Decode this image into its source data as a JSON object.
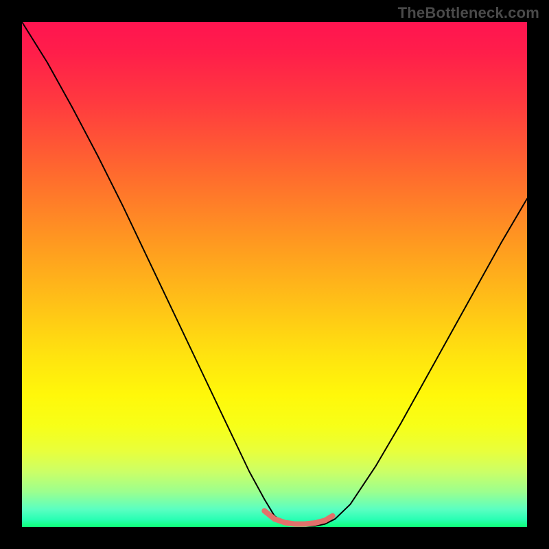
{
  "watermark": "TheBottleneck.com",
  "chart_data": {
    "type": "line",
    "title": "",
    "xlabel": "",
    "ylabel": "",
    "xlim": [
      0,
      100
    ],
    "ylim": [
      0,
      100
    ],
    "grid": false,
    "legend": false,
    "note": "Axes are unitless/unlabeled in the source image; values are estimated from pixel positions. Background colour gradient runs vertically from red (top, y≈100) through orange/yellow to green (bottom, y≈0). The black curve is a V-shaped line with a flat trough near y≈0 around x≈50–60; a short salmon segment highlights the flat trough.",
    "series": [
      {
        "name": "curve",
        "color": "#000000",
        "x": [
          0.0,
          5.0,
          10.0,
          15.0,
          20.0,
          25.0,
          30.0,
          35.0,
          40.0,
          45.0,
          48.0,
          50.0,
          52.0,
          55.0,
          58.0,
          60.0,
          62.0,
          65.0,
          70.0,
          75.0,
          80.0,
          85.0,
          90.0,
          95.0,
          100.0
        ],
        "y": [
          100.0,
          92.0,
          83.0,
          73.5,
          63.5,
          53.0,
          42.5,
          32.0,
          21.5,
          11.0,
          5.5,
          2.2,
          0.8,
          0.2,
          0.2,
          0.6,
          1.6,
          4.5,
          12.0,
          20.5,
          29.5,
          38.5,
          47.5,
          56.5,
          65.0
        ]
      },
      {
        "name": "trough-marker",
        "color": "#e3716b",
        "x": [
          48.0,
          50.0,
          52.0,
          54.0,
          56.0,
          58.0,
          60.0,
          61.5
        ],
        "y": [
          3.2,
          1.6,
          0.9,
          0.6,
          0.6,
          0.8,
          1.3,
          2.2
        ]
      }
    ],
    "background_gradient_stops": [
      {
        "pos": 0.0,
        "color": "#ff1450"
      },
      {
        "pos": 0.3,
        "color": "#ff6a2e"
      },
      {
        "pos": 0.56,
        "color": "#ffc217"
      },
      {
        "pos": 0.8,
        "color": "#f7ff18"
      },
      {
        "pos": 1.0,
        "color": "#0fff77"
      }
    ]
  }
}
